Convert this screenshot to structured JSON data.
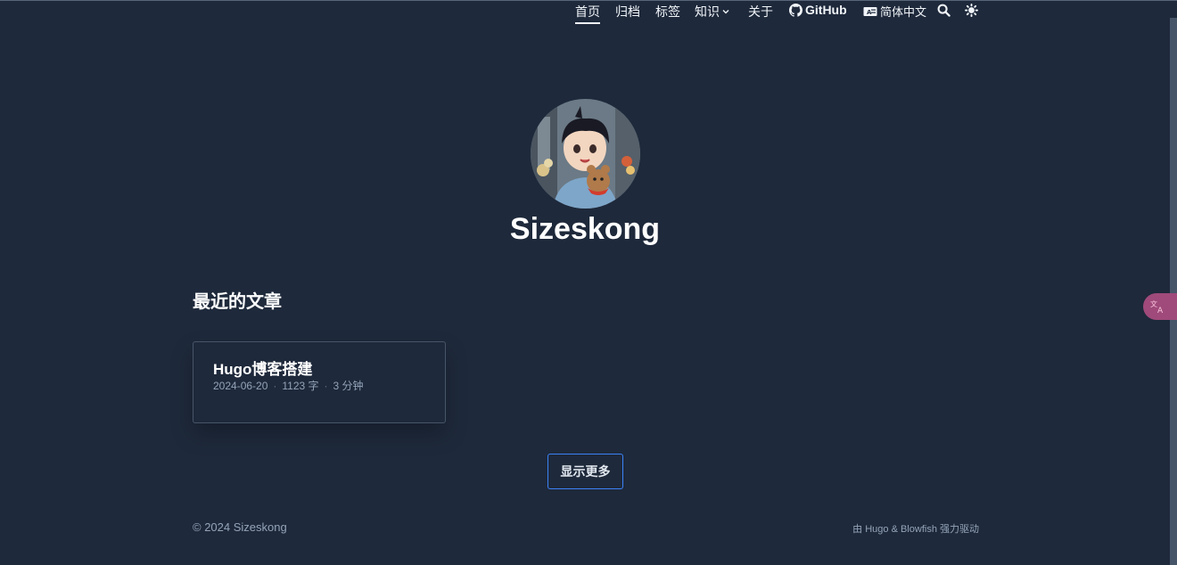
{
  "nav": {
    "home": "首页",
    "archive": "归档",
    "tags": "标签",
    "knowledge": "知识",
    "about": "关于",
    "github": "GitHub",
    "language": "简体中文"
  },
  "hero": {
    "title": "Sizeskong"
  },
  "recent": {
    "heading": "最近的文章",
    "posts": [
      {
        "title": "Hugo博客搭建",
        "date": "2024-06-20",
        "words": "1123 字",
        "read_time": "3 分钟"
      }
    ],
    "more_label": "显示更多"
  },
  "footer": {
    "copyright": "© 2024 Sizeskong",
    "powered_by": "由 Hugo & Blowfish 强力驱动"
  },
  "colors": {
    "background": "#1e293b",
    "accent": "#3b82f6",
    "translate": "#9f4a7a"
  }
}
